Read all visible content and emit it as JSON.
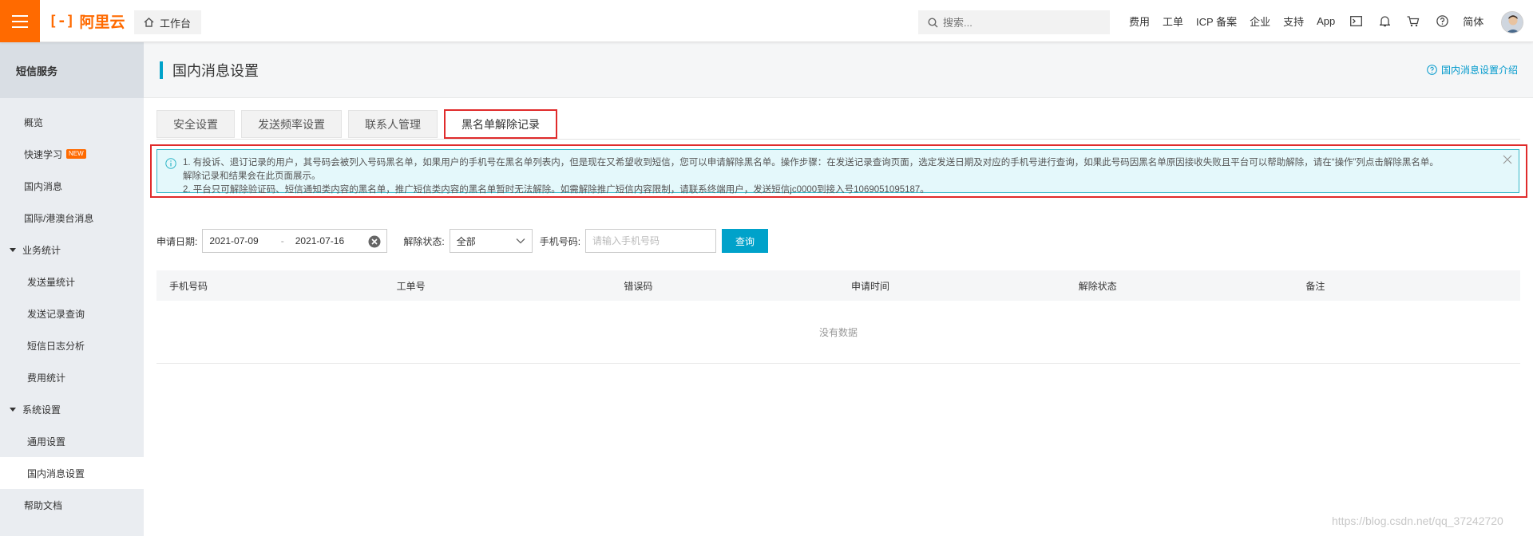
{
  "topbar": {
    "brand": "阿里云",
    "brand_mark": "[-]",
    "workbench": "工作台",
    "search_placeholder": "搜索...",
    "nav": [
      "费用",
      "工单",
      "ICP 备案",
      "企业",
      "支持",
      "App"
    ],
    "lang": "简体"
  },
  "sidebar": {
    "title": "短信服务",
    "items": [
      {
        "label": "概览"
      },
      {
        "label": "快速学习",
        "badge": "NEW"
      },
      {
        "label": "国内消息"
      },
      {
        "label": "国际/港澳台消息"
      }
    ],
    "group_stats": {
      "label": "业务统计",
      "items": [
        "发送量统计",
        "发送记录查询",
        "短信日志分析",
        "费用统计"
      ]
    },
    "group_settings": {
      "label": "系统设置",
      "items": [
        "通用设置",
        "国内消息设置"
      ]
    },
    "help": "帮助文档"
  },
  "page": {
    "title": "国内消息设置",
    "help_link": "国内消息设置介绍",
    "tabs": [
      "安全设置",
      "发送频率设置",
      "联系人管理",
      "黑名单解除记录"
    ],
    "active_tab": "黑名单解除记录",
    "notice": {
      "line1": "1. 有投诉、退订记录的用户，其号码会被列入号码黑名单，如果用户的手机号在黑名单列表内，但是现在又希望收到短信，您可以申请解除黑名单。操作步骤：在发送记录查询页面，选定发送日期及对应的手机号进行查询，如果此号码因黑名单原因接收失败且平台可以帮助解除，请在“操作”列点击解除黑名单。",
      "line1b": "解除记录和结果会在此页面展示。",
      "line2": "2. 平台只可解除验证码、短信通知类内容的黑名单，推广短信类内容的黑名单暂时无法解除。如需解除推广短信内容限制，请联系终端用户，发送短信jc0000到接入号1069051095187。"
    },
    "filters": {
      "date_label": "申请日期:",
      "date_start": "2021-07-09",
      "date_sep": "-",
      "date_end": "2021-07-16",
      "status_label": "解除状态:",
      "status_value": "全部",
      "phone_label": "手机号码:",
      "phone_placeholder": "请输入手机号码",
      "query_button": "查询"
    },
    "table": {
      "columns": [
        "手机号码",
        "工单号",
        "错误码",
        "申请时间",
        "解除状态",
        "备注"
      ],
      "empty_text": "没有数据"
    }
  },
  "watermark": "https://blog.csdn.net/qq_37242720",
  "colors": {
    "brand_orange": "#ff6a00",
    "accent_blue": "#00a2ca",
    "highlight_red": "#e02b2b",
    "notice_bg": "#e4f8fb"
  }
}
